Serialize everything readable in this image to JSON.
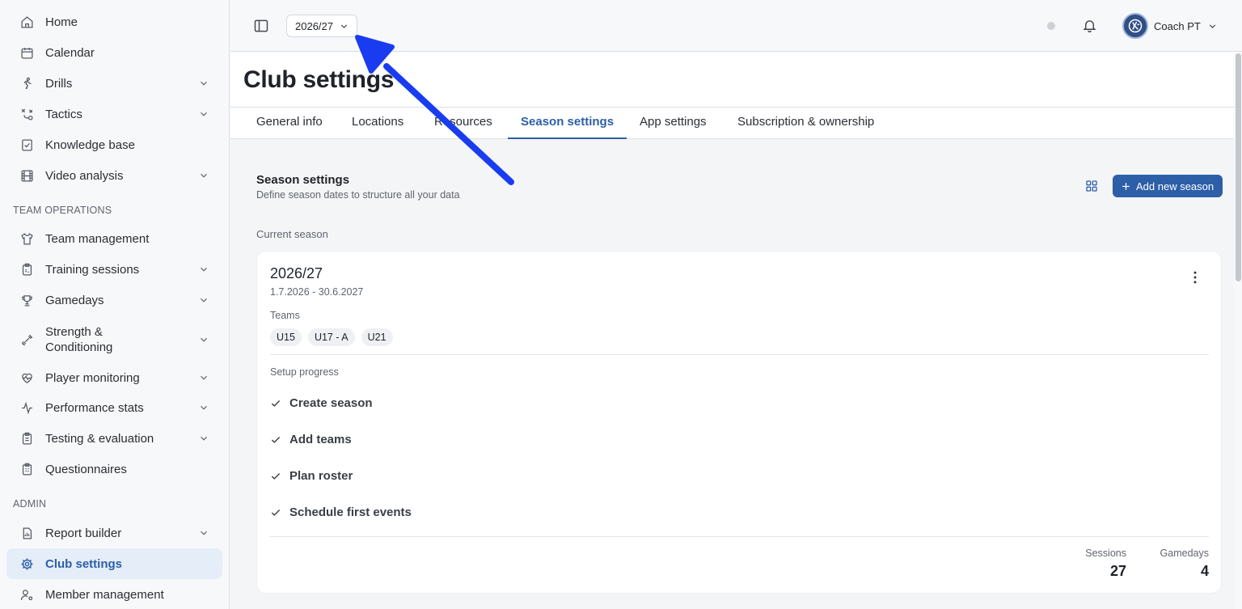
{
  "sidebar": {
    "items": [
      {
        "label": "Home",
        "icon": "home-icon"
      },
      {
        "label": "Calendar",
        "icon": "calendar-icon"
      },
      {
        "label": "Drills",
        "icon": "running-icon"
      },
      {
        "label": "Tactics",
        "icon": "tactics-icon"
      },
      {
        "label": "Knowledge base",
        "icon": "knowledge-icon"
      },
      {
        "label": "Video analysis",
        "icon": "film-icon"
      },
      {
        "label": "Team management",
        "icon": "shirt-icon"
      },
      {
        "label": "Training sessions",
        "icon": "clipboard-icon"
      },
      {
        "label": "Gamedays",
        "icon": "trophy-icon"
      },
      {
        "label": "Strength & Conditioning",
        "icon": "dumbbell-icon"
      },
      {
        "label": "Player monitoring",
        "icon": "heart-pulse-icon"
      },
      {
        "label": "Performance stats",
        "icon": "activity-icon"
      },
      {
        "label": "Testing & evaluation",
        "icon": "checklist-icon"
      },
      {
        "label": "Questionnaires",
        "icon": "questionnaire-icon"
      },
      {
        "label": "Report builder",
        "icon": "report-icon"
      },
      {
        "label": "Club settings",
        "icon": "gear-icon"
      },
      {
        "label": "Member management",
        "icon": "user-settings-icon"
      }
    ],
    "sections": {
      "team_operations": "TEAM OPERATIONS",
      "admin": "ADMIN"
    }
  },
  "topbar": {
    "season": "2026/27",
    "user_name": "Coach PT"
  },
  "page": {
    "title": "Club settings",
    "tabs": [
      "General info",
      "Locations",
      "Resources",
      "Season settings",
      "App settings",
      "Subscription & ownership"
    ],
    "active_tab": "Season settings"
  },
  "season_settings": {
    "title": "Season settings",
    "subtitle": "Define season dates to structure all your data",
    "add_button": "Add new season",
    "current_label": "Current season",
    "card": {
      "name": "2026/27",
      "dates": "1.7.2026 - 30.6.2027",
      "teams_label": "Teams",
      "teams": [
        "U15",
        "U17 - A",
        "U21"
      ],
      "setup_label": "Setup progress",
      "steps": [
        "Create season",
        "Add teams",
        "Plan roster",
        "Schedule first events"
      ],
      "sessions_label": "Sessions",
      "sessions_value": "27",
      "gamedays_label": "Gamedays",
      "gamedays_value": "4"
    }
  },
  "colors": {
    "accent": "#2d5fa8",
    "annotation_arrow": "#1a3cf0"
  }
}
